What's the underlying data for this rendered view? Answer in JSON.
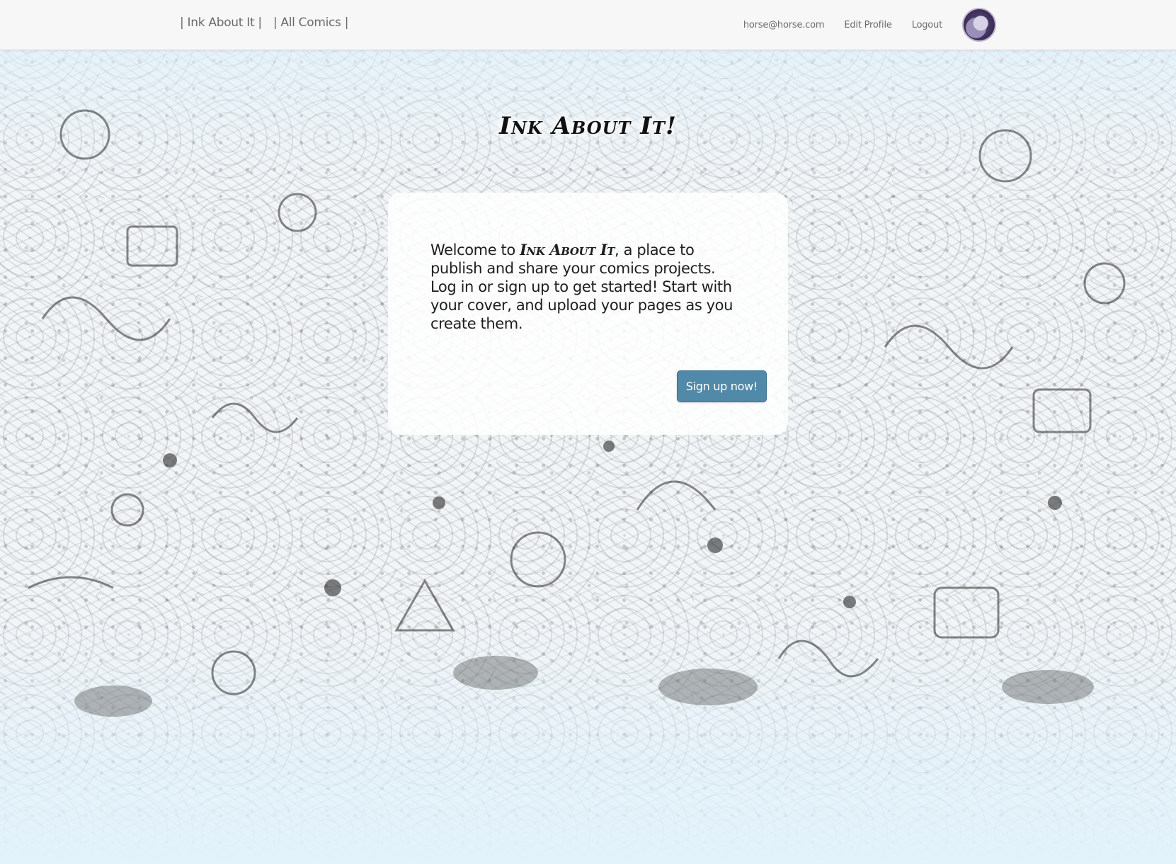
{
  "nav": {
    "brand": "| Ink About It |",
    "all_comics": "| All Comics |",
    "user_email": "horse@horse.com",
    "edit_profile": "Edit Profile",
    "logout": "Logout"
  },
  "hero": {
    "title": "Ink About It!"
  },
  "welcome": {
    "prefix": "Welcome to ",
    "brand": "Ink About It",
    "body": ", a place to publish and share your comics projects. Log in or sign up to get started! Start with your cover, and upload your pages as you create them.",
    "signup_label": "Sign up now!"
  },
  "colors": {
    "button": "#5189a8",
    "navbar": "#f7f7f7",
    "background_tint": "#dff1fb"
  },
  "icons": {
    "avatar": "user-avatar-image"
  }
}
